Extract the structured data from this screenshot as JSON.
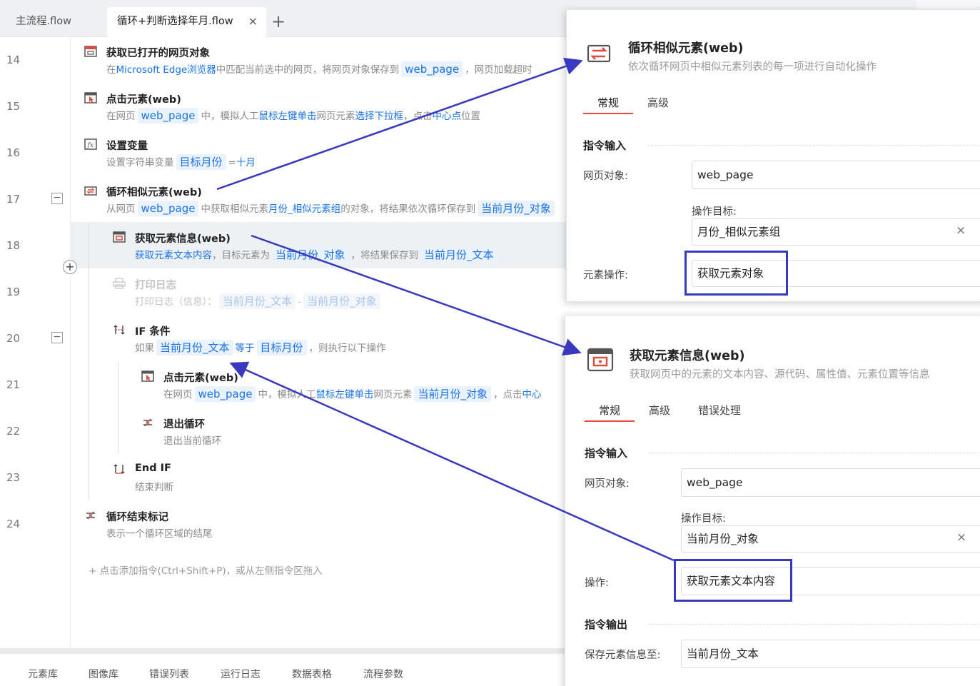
{
  "tabs": {
    "main": "主流程.flow",
    "loop": "循环+判断选择年月.flow",
    "close": "×",
    "add": "+"
  },
  "lines": [
    "14",
    "15",
    "16",
    "17",
    "18",
    "19",
    "20",
    "21",
    "22",
    "23",
    "24"
  ],
  "steps": {
    "s14": {
      "title": "获取已打开的网页对象",
      "d1": "在",
      "k1": "Microsoft Edge浏览器",
      "d2": "中匹配当前选中的网页，将网页对象保存到",
      "c1": "web_page",
      "d3": "，网页加载超时"
    },
    "s15": {
      "title": "点击元素(web)",
      "d1": "在网页",
      "c1": "web_page",
      "d2": "中，模拟人工",
      "k1": "鼠标左键单击",
      "d3": "网页元素",
      "k2": "选择下拉框",
      "d4": "，点击",
      "k3": "中心点",
      "d5": "位置"
    },
    "s16": {
      "title": "设置变量",
      "d1": "设置字符串变量",
      "c1": "目标月份",
      "d2": "=",
      "k1": "十月"
    },
    "s17": {
      "title": "循环相似元素(web)",
      "d1": "从网页",
      "c1": "web_page",
      "d2": "中获取相似元素",
      "k1": "月份_相似元素组",
      "d3": "的对象，将结果依次循环保存到",
      "c2": "当前月份_对象"
    },
    "s18": {
      "title": "获取元素信息(web)",
      "k1": "获取元素文本内容",
      "d1": "，目标元素为",
      "c1": "当前月份_对象",
      "d2": "，将结果保存到",
      "c2": "当前月份_文本"
    },
    "s19": {
      "title": "打印日志",
      "d1": "打印日志（信息）：",
      "c1": "当前月份_文本",
      "d2": "-",
      "c2": "当前月份_对象"
    },
    "s20": {
      "title": "IF 条件",
      "d1": "如果",
      "c1": "当前月份_文本",
      "k1": "等于",
      "c2": "目标月份",
      "d2": "，则执行以下操作"
    },
    "s21": {
      "title": "点击元素(web)",
      "d1": "在网页",
      "c1": "web_page",
      "d2": "中，模拟人工",
      "k1": "鼠标左键单击",
      "d3": "网页元素",
      "c2": "当前月份_对象",
      "d4": "，点击",
      "k2": "中心"
    },
    "s22": {
      "title": "退出循环",
      "d1": "退出当前循环"
    },
    "s23": {
      "title": "End IF",
      "d1": "结束判断"
    },
    "s24": {
      "title": "循环结束标记",
      "d1": "表示一个循环区域的结尾"
    }
  },
  "insert_plus": "+",
  "add_hint": "+  点击添加指令(Ctrl+Shift+P)，或从左侧指令区拖入",
  "bottom_tabs": [
    "元素库",
    "图像库",
    "错误列表",
    "运行日志",
    "数据表格",
    "流程参数"
  ],
  "panel_loop": {
    "title": "循环相似元素(web)",
    "subtitle": "依次循环网页中相似元素列表的每一项进行自动化操作",
    "tabs": [
      "常规",
      "高级"
    ],
    "section_input": "指令输入",
    "web_label": "网页对象:",
    "web_value": "web_page",
    "target_label": "操作目标:",
    "target_value": "月份_相似元素组",
    "clear": "×",
    "op_label": "元素操作:",
    "op_value": "获取元素对象"
  },
  "panel_info": {
    "title": "获取元素信息(web)",
    "subtitle": "获取网页中的元素的文本内容、源代码、属性值、元素位置等信息",
    "tabs": [
      "常规",
      "高级",
      "错误处理"
    ],
    "section_input": "指令输入",
    "web_label": "网页对象:",
    "web_value": "web_page",
    "target_label": "操作目标:",
    "target_value": "当前月份_对象",
    "clear": "×",
    "op_label": "操作:",
    "op_value": "获取元素文本内容",
    "section_output": "指令输出",
    "save_label": "保存元素信息至:",
    "save_value": "当前月份_文本"
  },
  "colors": {
    "accent_red": "#e24a3b",
    "link_blue": "#1a73e8",
    "annotation": "#3838c0"
  }
}
